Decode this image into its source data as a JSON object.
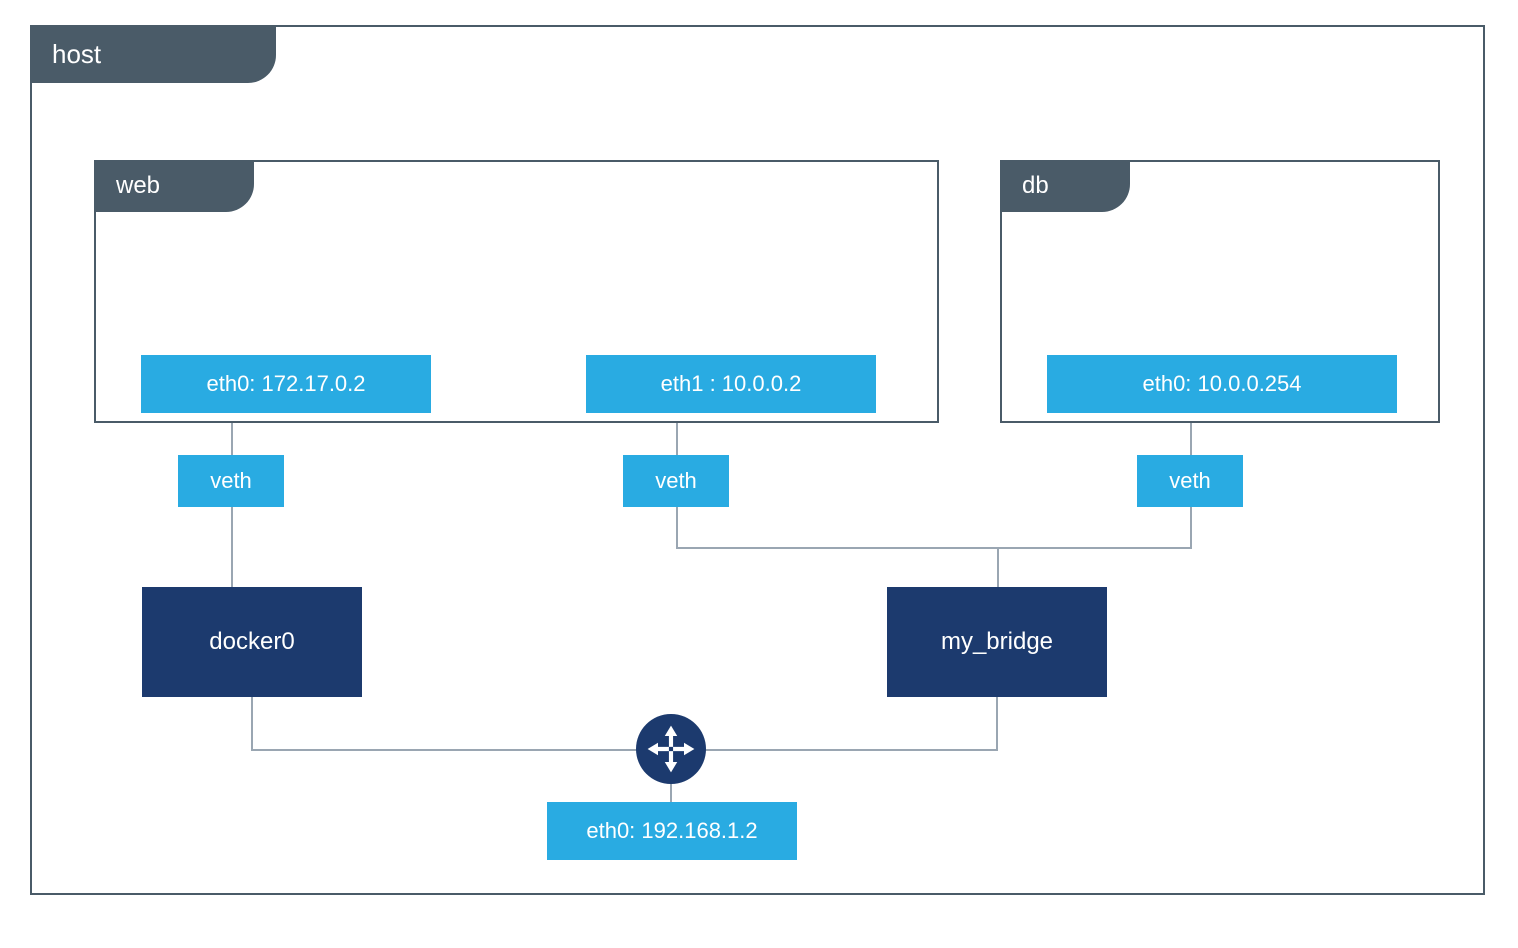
{
  "host": {
    "label": "host"
  },
  "containers": {
    "web": {
      "label": "web",
      "interfaces": [
        {
          "label": "eth0: 172.17.0.2"
        },
        {
          "label": "eth1 : 10.0.0.2"
        }
      ]
    },
    "db": {
      "label": "db",
      "interfaces": [
        {
          "label": "eth0: 10.0.0.254"
        }
      ]
    }
  },
  "veth": {
    "a": "veth",
    "b": "veth",
    "c": "veth"
  },
  "bridges": {
    "docker0": "docker0",
    "my_bridge": "my_bridge"
  },
  "host_iface": {
    "label": "eth0: 192.168.1.2"
  },
  "colors": {
    "tab": "#4a5b68",
    "light": "#29abe2",
    "dark": "#1c3a6e",
    "line": "#9aa6b2"
  }
}
